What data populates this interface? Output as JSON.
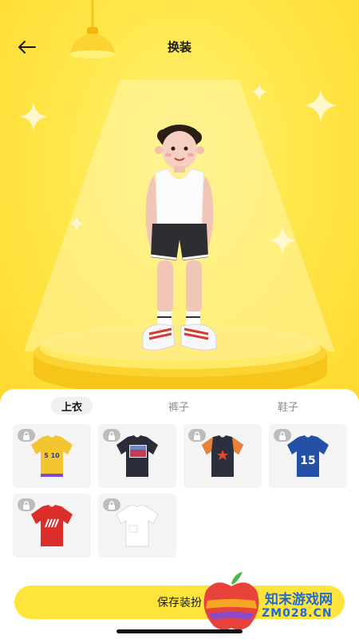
{
  "header": {
    "title": "换装"
  },
  "icons": {
    "back": "back-arrow-icon",
    "lock": "lock-icon",
    "lamp": "ceiling-lamp-icon",
    "sparkle": "sparkle-icon"
  },
  "tabs": [
    {
      "label": "上衣",
      "active": true
    },
    {
      "label": "裤子",
      "active": false
    },
    {
      "label": "鞋子",
      "active": false
    }
  ],
  "items": [
    {
      "name": "yellow-jersey",
      "label": "5 10",
      "locked": true
    },
    {
      "name": "black-print-tee",
      "label": "",
      "locked": true
    },
    {
      "name": "star-tee",
      "label": "",
      "locked": true
    },
    {
      "name": "blue-jersey",
      "label": "15",
      "locked": true
    },
    {
      "name": "red-stripe-tee",
      "label": "",
      "locked": true
    },
    {
      "name": "white-tee",
      "label": "",
      "locked": true
    }
  ],
  "save_button": {
    "label": "保存装扮"
  },
  "watermark": {
    "line1": "知末游戏网",
    "line2": "ZM028.CN"
  },
  "colors": {
    "accent": "#FFE53B",
    "background": "#FFE34A"
  }
}
